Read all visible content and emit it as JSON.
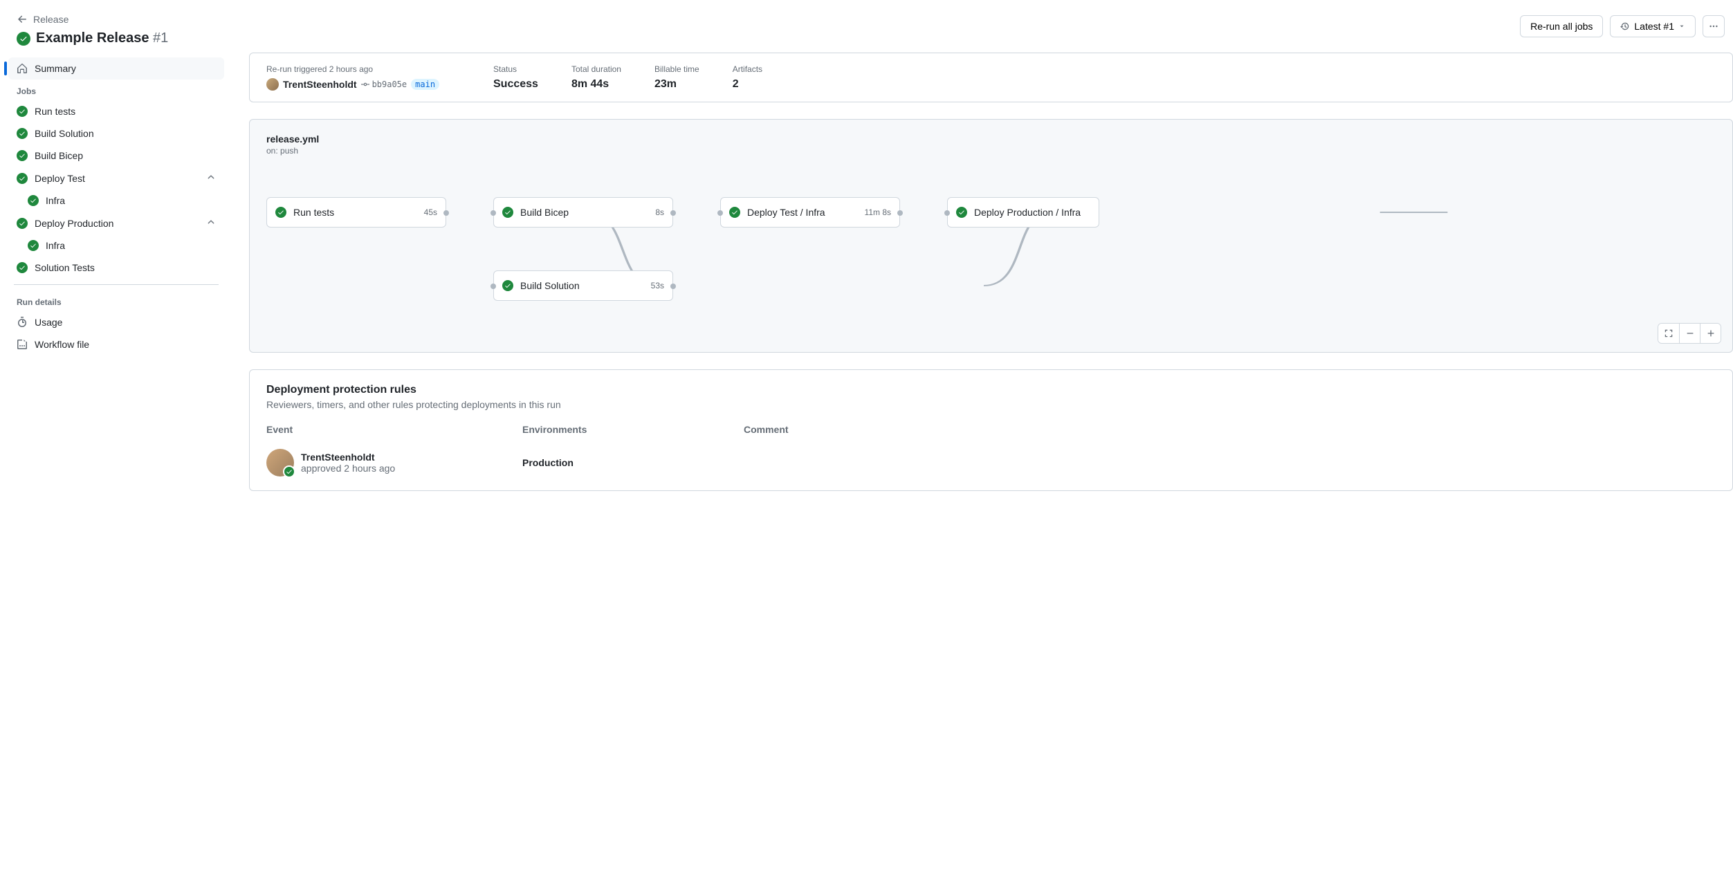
{
  "breadcrumb": {
    "parent": "Release"
  },
  "page_title": {
    "name": "Example Release",
    "number": "#1"
  },
  "topbar": {
    "rerun_label": "Re-run all jobs",
    "latest_label": "Latest #1"
  },
  "sidebar": {
    "summary_label": "Summary",
    "jobs_heading": "Jobs",
    "jobs": [
      {
        "label": "Run tests",
        "sub": null
      },
      {
        "label": "Build Solution",
        "sub": null
      },
      {
        "label": "Build Bicep",
        "sub": null
      },
      {
        "label": "Deploy Test",
        "sub": "Infra"
      },
      {
        "label": "Deploy Production",
        "sub": "Infra"
      },
      {
        "label": "Solution Tests",
        "sub": null
      }
    ],
    "run_details_heading": "Run details",
    "usage_label": "Usage",
    "workflow_file_label": "Workflow file"
  },
  "info": {
    "trigger_label": "Re-run triggered 2 hours ago",
    "trigger_user": "TrentSteenholdt",
    "commit_sha": "bb9a05e",
    "branch": "main",
    "status_label": "Status",
    "status_value": "Success",
    "duration_label": "Total duration",
    "duration_value": "8m 44s",
    "billable_label": "Billable time",
    "billable_value": "23m",
    "artifacts_label": "Artifacts",
    "artifacts_value": "2"
  },
  "graph": {
    "file": "release.yml",
    "trigger": "on: push",
    "nodes": {
      "run_tests": {
        "label": "Run tests",
        "time": "45s"
      },
      "build_bicep": {
        "label": "Build Bicep",
        "time": "8s"
      },
      "build_solution": {
        "label": "Build Solution",
        "time": "53s"
      },
      "deploy_test": {
        "label": "Deploy Test / Infra",
        "time": "11m 8s"
      },
      "deploy_prod": {
        "label": "Deploy Production / Infra",
        "time": ""
      }
    }
  },
  "rules": {
    "title": "Deployment protection rules",
    "subtitle": "Reviewers, timers, and other rules protecting deployments in this run",
    "headers": {
      "event": "Event",
      "environments": "Environments",
      "comment": "Comment"
    },
    "rows": [
      {
        "user": "TrentSteenholdt",
        "action": "approved 2 hours ago",
        "environment": "Production",
        "comment": ""
      }
    ]
  }
}
